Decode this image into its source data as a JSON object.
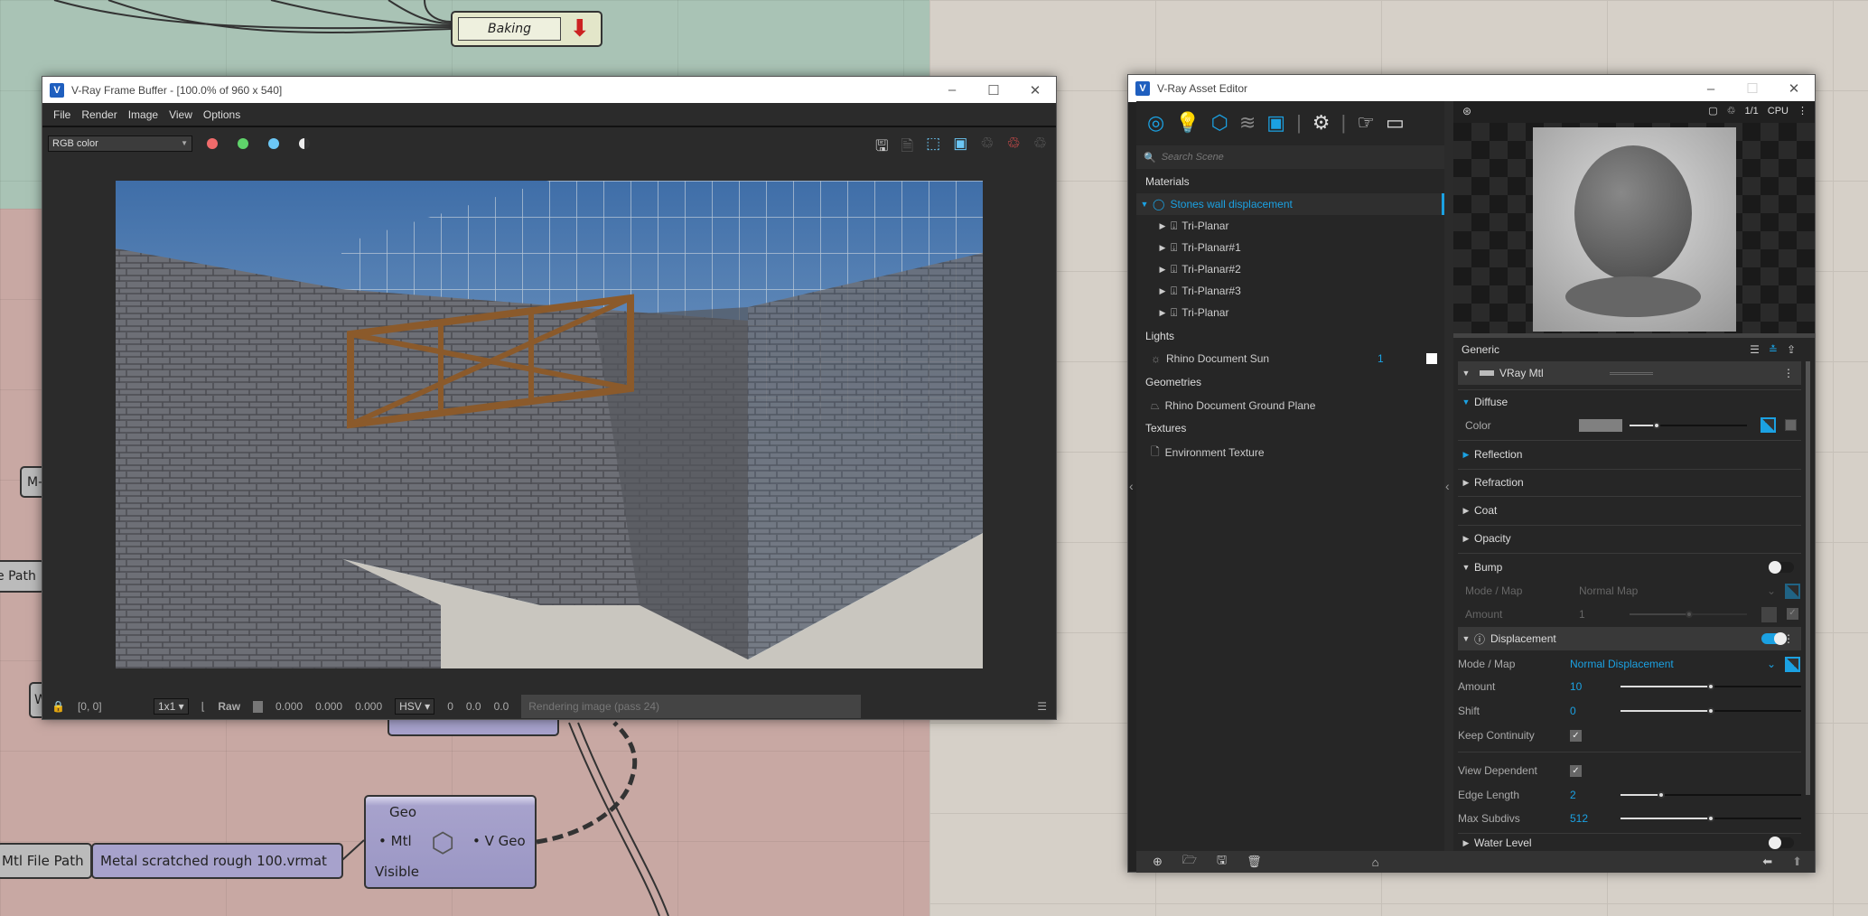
{
  "grasshopper": {
    "baking_node": {
      "label": "Baking"
    },
    "partial_nodes": [
      "M-",
      "e Path",
      "W"
    ],
    "mtl_path_label": "Mtl File Path",
    "mtl_path_value": "Metal scratched rough 100.vrmat",
    "component": {
      "inputs": [
        "Geo",
        "Mtl",
        "Visible"
      ],
      "output": "V Geo"
    }
  },
  "frame_buffer": {
    "title": "V-Ray Frame Buffer - [100.0% of 960 x 540]",
    "menu": [
      "File",
      "Render",
      "Image",
      "View",
      "Options"
    ],
    "channel": "RGB color",
    "channel_dots": {
      "red": "#f06b6b",
      "green": "#5fd36a",
      "blue": "#6cc7f5"
    },
    "status": {
      "coords": "[0, 0]",
      "zoom": "1x1",
      "raw_label": "Raw",
      "r": "0.000",
      "g": "0.000",
      "b": "0.000",
      "color_mode": "HSV",
      "h": "0",
      "s": "0.0",
      "v": "0.0",
      "message": "Rendering image (pass 24)"
    }
  },
  "asset_editor": {
    "title": "V-Ray Asset Editor",
    "search_placeholder": "Search Scene",
    "preview": {
      "fraction": "1/1",
      "device": "CPU"
    },
    "sections": {
      "materials": "Materials",
      "lights": "Lights",
      "geometries": "Geometries",
      "textures": "Textures"
    },
    "material": "Stones wall displacement",
    "sub_textures": [
      "Tri-Planar",
      "Tri-Planar#1",
      "Tri-Planar#2",
      "Tri-Planar#3",
      "Tri-Planar"
    ],
    "light": {
      "name": "Rhino Document Sun",
      "count": "1"
    },
    "geometry": "Rhino Document Ground Plane",
    "texture": "Environment Texture",
    "props": {
      "generic": "Generic",
      "vray_mtl": "VRay Mtl",
      "diffuse": "Diffuse",
      "color": "Color",
      "reflection": "Reflection",
      "refraction": "Refraction",
      "coat": "Coat",
      "opacity": "Opacity",
      "bump": "Bump",
      "bump_mode_label": "Mode / Map",
      "bump_mode": "Normal Map",
      "bump_amount_label": "Amount",
      "bump_amount": "1",
      "displacement": "Displacement",
      "disp_mode_label": "Mode / Map",
      "disp_mode": "Normal Displacement",
      "amount_label": "Amount",
      "amount": "10",
      "shift_label": "Shift",
      "shift": "0",
      "keep_continuity": "Keep Continuity",
      "view_dependent": "View Dependent",
      "edge_length_label": "Edge Length",
      "edge_length": "2",
      "max_subdivs_label": "Max Subdivs",
      "max_subdivs": "512",
      "water_level": "Water Level"
    },
    "toggles": {
      "bump": false,
      "displacement": true,
      "water_level": false
    },
    "accent": "#1ba1e2"
  }
}
